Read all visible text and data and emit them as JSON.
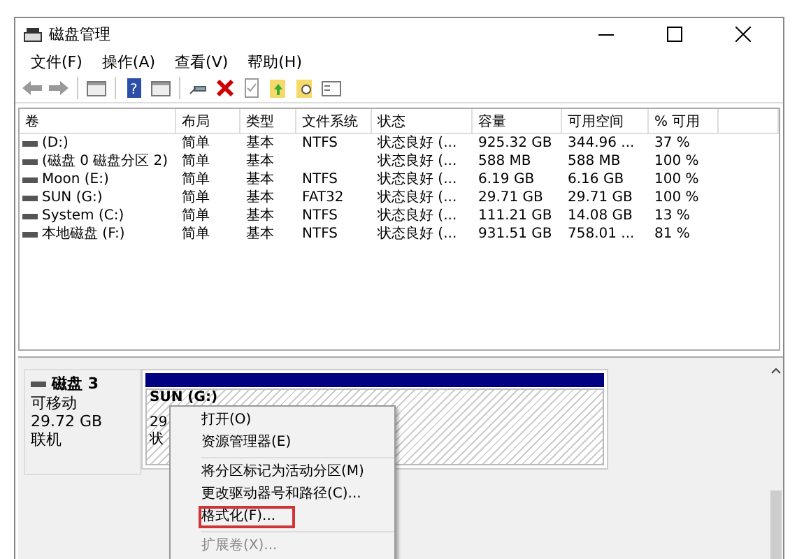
{
  "window": {
    "title": "磁盘管理"
  },
  "menu": [
    "文件(F)",
    "操作(A)",
    "查看(V)",
    "帮助(H)"
  ],
  "toolbar": {
    "help_glyph": "?"
  },
  "table": {
    "columns": [
      "卷",
      "布局",
      "类型",
      "文件系统",
      "状态",
      "容量",
      "可用空间",
      "% 可用"
    ],
    "rows": [
      [
        "(D:)",
        "简单",
        "基本",
        "NTFS",
        "状态良好 (...",
        "925.32 GB",
        "344.96 ...",
        "37 %"
      ],
      [
        "(磁盘 0 磁盘分区 2)",
        "简单",
        "基本",
        "",
        "状态良好 (...",
        "588 MB",
        "588 MB",
        "100 %"
      ],
      [
        "Moon (E:)",
        "简单",
        "基本",
        "NTFS",
        "状态良好 (...",
        "6.19 GB",
        "6.16 GB",
        "100 %"
      ],
      [
        "SUN (G:)",
        "简单",
        "基本",
        "FAT32",
        "状态良好 (...",
        "29.71 GB",
        "29.71 GB",
        "100 %"
      ],
      [
        "System (C:)",
        "简单",
        "基本",
        "NTFS",
        "状态良好 (...",
        "111.21 GB",
        "14.08 GB",
        "13 %"
      ],
      [
        "本地磁盘 (F:)",
        "简单",
        "基本",
        "NTFS",
        "状态良好 (...",
        "931.51 GB",
        "758.01 ...",
        "81 %"
      ]
    ]
  },
  "disk": {
    "name": "磁盘 3",
    "lines": [
      "可移动",
      "29.72 GB",
      "联机"
    ],
    "partition": {
      "lines": [
        "SUN (G:)",
        "29",
        "状"
      ]
    }
  },
  "context_menu": [
    {
      "label": "打开(O)",
      "disabled": false,
      "highlighted": false
    },
    {
      "label": "资源管理器(E)",
      "disabled": false,
      "highlighted": false
    },
    {
      "kind": "separator"
    },
    {
      "label": "将分区标记为活动分区(M)",
      "disabled": false,
      "highlighted": false
    },
    {
      "label": "更改驱动器号和路径(C)...",
      "disabled": false,
      "highlighted": false
    },
    {
      "label": "格式化(F)...",
      "disabled": false,
      "highlighted": true
    },
    {
      "kind": "separator"
    },
    {
      "label": "扩展卷(X)...",
      "disabled": true,
      "highlighted": false
    }
  ]
}
